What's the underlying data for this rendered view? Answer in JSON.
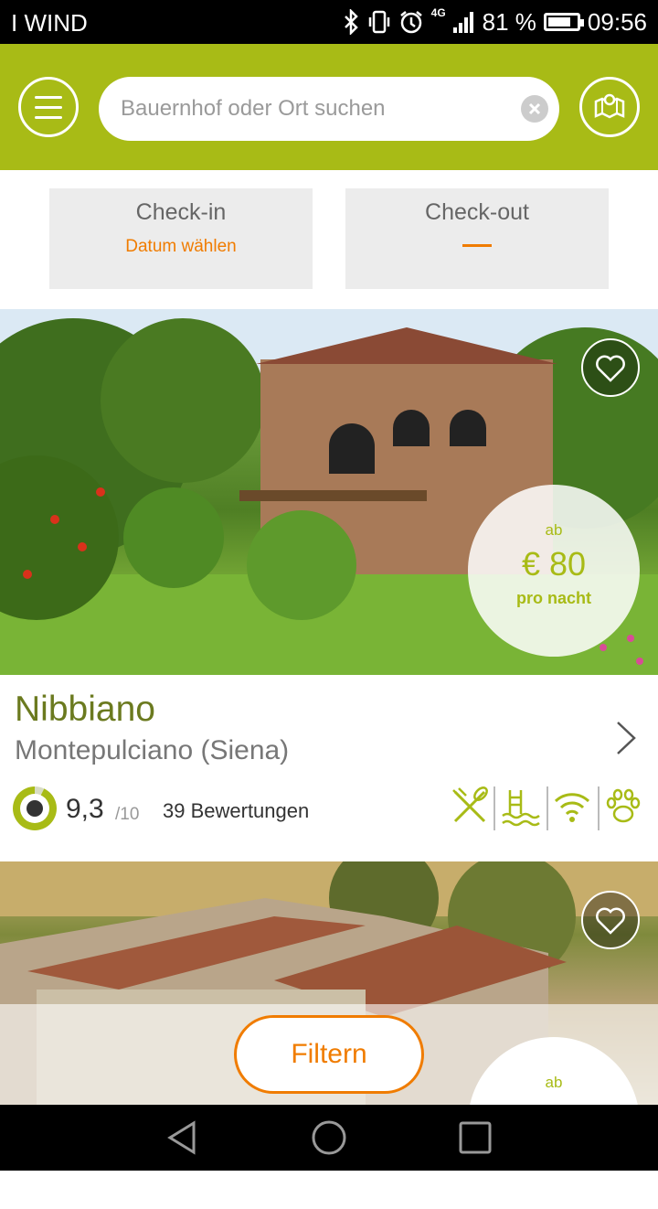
{
  "statusbar": {
    "carrier": "I WIND",
    "network": "4G",
    "battery_percent": "81 %",
    "battery_level": 0.81,
    "time": "09:56"
  },
  "search": {
    "placeholder": "Bauernhof oder Ort suchen"
  },
  "dates": {
    "checkin_label": "Check-in",
    "checkin_value": "Datum wählen",
    "checkout_label": "Check-out"
  },
  "listing1": {
    "price_prefix": "ab",
    "price": "€ 80",
    "price_suffix": "pro nacht",
    "name": "Nibbiano",
    "location": "Montepulciano (Siena)",
    "rating": "9,3",
    "rating_max": "/10",
    "rating_fraction": 0.93,
    "reviews": "39 Bewertungen",
    "amenities": [
      "restaurant-icon",
      "pool-icon",
      "wifi-icon",
      "pets-icon"
    ]
  },
  "listing2": {
    "price_prefix": "ab"
  },
  "filter_label": "Filtern",
  "colors": {
    "brand_green": "#a8bb16",
    "accent_orange": "#f07c00",
    "title_green": "#6b7a1f"
  }
}
